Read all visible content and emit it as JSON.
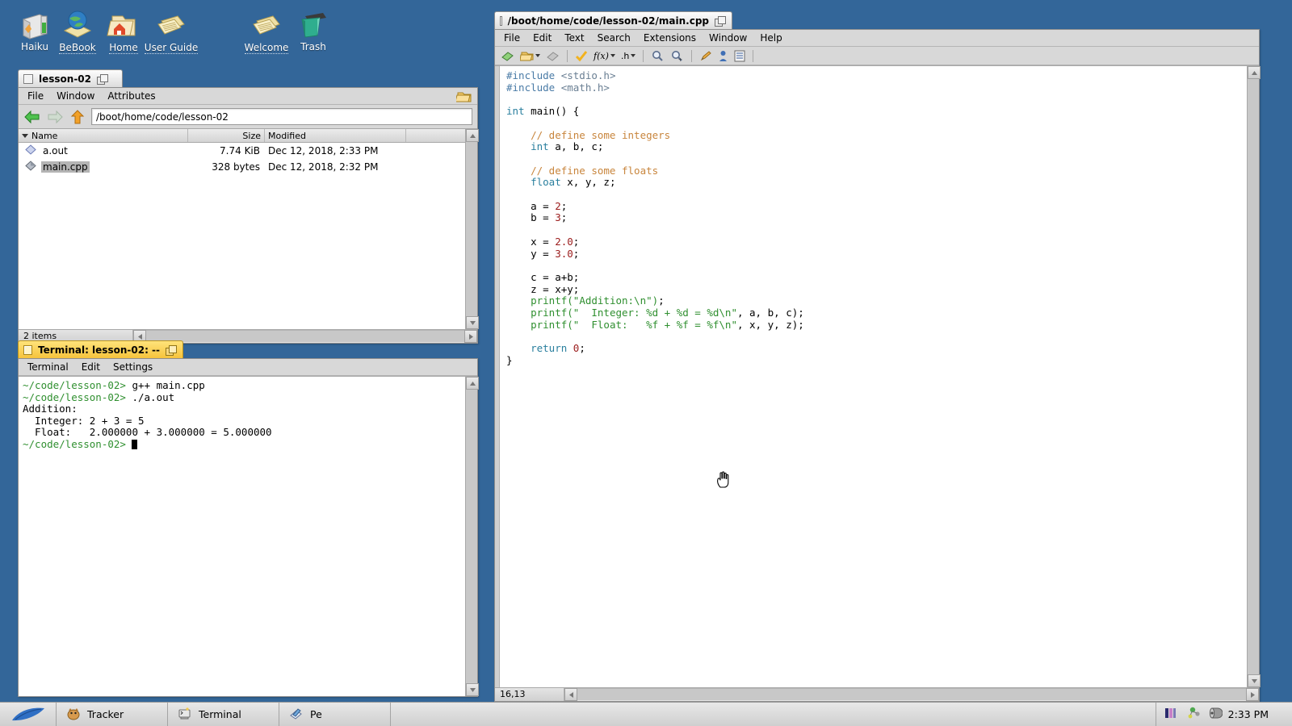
{
  "desktop": {
    "background_color": "#336699",
    "icons": [
      {
        "label": "Haiku",
        "icon": "haiku-disk-icon",
        "underlined": false
      },
      {
        "label": "BeBook",
        "icon": "bebook-globe-icon",
        "underlined": true
      },
      {
        "label": "Home",
        "icon": "home-folder-icon",
        "underlined": true
      },
      {
        "label": "User Guide",
        "icon": "document-icon",
        "underlined": true
      },
      {
        "label": "Welcome",
        "icon": "document-icon",
        "underlined": true
      },
      {
        "label": "Trash",
        "icon": "trash-icon",
        "underlined": false
      }
    ]
  },
  "tracker": {
    "title": "lesson-02",
    "menus": [
      "File",
      "Window",
      "Attributes"
    ],
    "menubar_icon": "folder-icon",
    "nav": {
      "back_icon": "back-arrow-icon",
      "forward_icon": "forward-arrow-icon",
      "up_icon": "up-arrow-icon",
      "path": "/boot/home/code/lesson-02",
      "path_placeholder": "/boot/home"
    },
    "columns": [
      {
        "key": "name",
        "label": "Name",
        "align": "left"
      },
      {
        "key": "size",
        "label": "Size",
        "align": "right"
      },
      {
        "key": "mod",
        "label": "Modified",
        "align": "left"
      }
    ],
    "rows": [
      {
        "name": "a.out",
        "size": "7.74 KiB",
        "modified": "Dec 12, 2018, 2:33 PM",
        "icon": "binary-file-icon",
        "selected": false
      },
      {
        "name": "main.cpp",
        "size": "328 bytes",
        "modified": "Dec 12, 2018, 2:32 PM",
        "icon": "source-file-icon",
        "selected": true
      }
    ],
    "status": "2 items"
  },
  "terminal": {
    "title": "Terminal: lesson-02: --",
    "menus": [
      "Terminal",
      "Edit",
      "Settings"
    ],
    "prompt": "~/code/lesson-02>",
    "lines": [
      {
        "prompt": "~/code/lesson-02>",
        "text": " g++ main.cpp"
      },
      {
        "prompt": "~/code/lesson-02>",
        "text": " ./a.out"
      },
      {
        "prompt": "",
        "text": "Addition:"
      },
      {
        "prompt": "",
        "text": "  Integer: 2 + 3 = 5"
      },
      {
        "prompt": "",
        "text": "  Float:   2.000000 + 3.000000 = 5.000000"
      },
      {
        "prompt": "~/code/lesson-02>",
        "text": " ",
        "cursor": true
      }
    ],
    "prompt_color": "#2f8f2f"
  },
  "editor": {
    "title": "/boot/home/code/lesson-02/main.cpp",
    "menus": [
      "File",
      "Edit",
      "Text",
      "Search",
      "Extensions",
      "Window",
      "Help"
    ],
    "toolbar": [
      {
        "name": "new-document-icon",
        "label": "",
        "dropdown": false
      },
      {
        "name": "open-folder-icon",
        "label": "",
        "dropdown": true
      },
      {
        "name": "save-icon",
        "label": "",
        "dropdown": false
      },
      {
        "name": "sep",
        "label": "",
        "dropdown": false
      },
      {
        "name": "checkmark-icon",
        "label": "",
        "dropdown": false
      },
      {
        "name": "functions-icon",
        "label": "f(x)",
        "dropdown": true
      },
      {
        "name": "header-icon",
        "label": ".h",
        "dropdown": true
      },
      {
        "name": "sep",
        "label": "",
        "dropdown": false
      },
      {
        "name": "find-icon",
        "label": "",
        "dropdown": false
      },
      {
        "name": "find-next-icon",
        "label": "",
        "dropdown": false
      },
      {
        "name": "sep",
        "label": "",
        "dropdown": false
      },
      {
        "name": "pencil-icon",
        "label": "",
        "dropdown": false
      },
      {
        "name": "person-icon",
        "label": "",
        "dropdown": false
      },
      {
        "name": "list-icon",
        "label": "",
        "dropdown": false
      }
    ],
    "status_position": "16,13",
    "code_lines": [
      [
        {
          "t": "#include ",
          "c": "pre"
        },
        {
          "t": "<stdio.h>",
          "c": "hdr"
        }
      ],
      [
        {
          "t": "#include ",
          "c": "pre"
        },
        {
          "t": "<math.h>",
          "c": "hdr"
        }
      ],
      [],
      [
        {
          "t": "int ",
          "c": "type"
        },
        {
          "t": "main() {",
          "c": "plain"
        }
      ],
      [],
      [
        {
          "t": "    // define some integers",
          "c": "cmt"
        }
      ],
      [
        {
          "t": "    ",
          "c": "plain"
        },
        {
          "t": "int ",
          "c": "type"
        },
        {
          "t": "a, b, c;",
          "c": "plain"
        }
      ],
      [],
      [
        {
          "t": "    // define some floats",
          "c": "cmt"
        }
      ],
      [
        {
          "t": "    ",
          "c": "plain"
        },
        {
          "t": "float ",
          "c": "type"
        },
        {
          "t": "x, y, z;",
          "c": "plain"
        }
      ],
      [],
      [
        {
          "t": "    a = ",
          "c": "plain"
        },
        {
          "t": "2",
          "c": "num"
        },
        {
          "t": ";",
          "c": "plain"
        }
      ],
      [
        {
          "t": "    b = ",
          "c": "plain"
        },
        {
          "t": "3",
          "c": "num"
        },
        {
          "t": ";",
          "c": "plain"
        }
      ],
      [],
      [
        {
          "t": "    x = ",
          "c": "plain"
        },
        {
          "t": "2.0",
          "c": "num"
        },
        {
          "t": ";",
          "c": "plain"
        }
      ],
      [
        {
          "t": "    y = ",
          "c": "plain"
        },
        {
          "t": "3.0",
          "c": "num"
        },
        {
          "t": ";",
          "c": "plain"
        }
      ],
      [],
      [
        {
          "t": "    c = a+b;",
          "c": "plain"
        }
      ],
      [
        {
          "t": "    z = x+y;",
          "c": "plain"
        }
      ],
      [
        {
          "t": "    ",
          "c": "plain"
        },
        {
          "t": "printf(\"Addition:\\n\")",
          "c": "str"
        },
        {
          "t": ";",
          "c": "plain"
        }
      ],
      [
        {
          "t": "    ",
          "c": "plain"
        },
        {
          "t": "printf(\"  Integer: %d + %d = %d\\n\"",
          "c": "str"
        },
        {
          "t": ", a, b, c);",
          "c": "plain"
        }
      ],
      [
        {
          "t": "    ",
          "c": "plain"
        },
        {
          "t": "printf(\"  Float:   %f + %f = %f\\n\"",
          "c": "str"
        },
        {
          "t": ", x, y, z);",
          "c": "plain"
        }
      ],
      [],
      [
        {
          "t": "    ",
          "c": "plain"
        },
        {
          "t": "return ",
          "c": "type"
        },
        {
          "t": "0",
          "c": "num"
        },
        {
          "t": ";",
          "c": "plain"
        }
      ],
      [
        {
          "t": "}",
          "c": "plain"
        }
      ]
    ]
  },
  "deskbar": {
    "leaf_icon": "haiku-leaf-icon",
    "tasks": [
      {
        "label": "Tracker",
        "icon": "tracker-icon"
      },
      {
        "label": "Terminal",
        "icon": "terminal-icon"
      },
      {
        "label": "Pe",
        "icon": "pe-icon"
      }
    ],
    "tray": [
      {
        "name": "power-status-icon"
      },
      {
        "name": "network-icon"
      },
      {
        "name": "volume-icon"
      }
    ],
    "clock": "2:33 PM"
  }
}
